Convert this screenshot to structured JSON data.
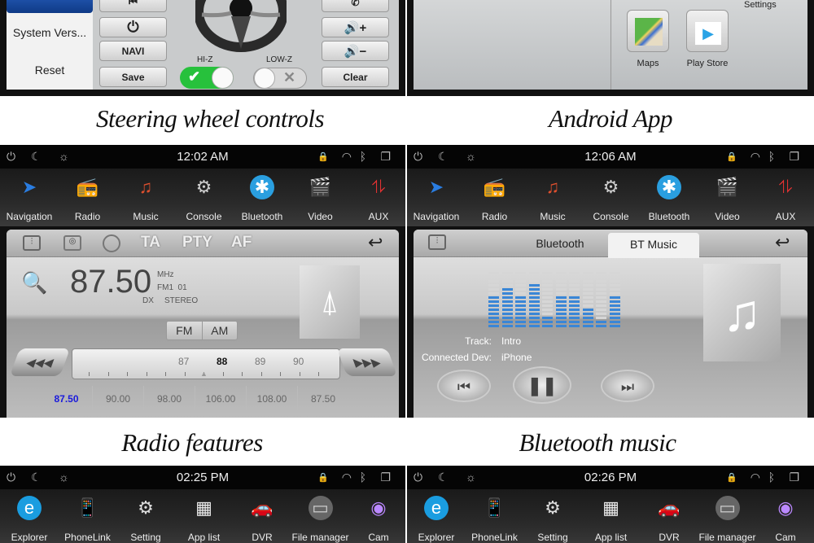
{
  "captions": {
    "steering": "Steering wheel controls",
    "android": "Android App",
    "radio": "Radio features",
    "bt_music": "Bluetooth music"
  },
  "steering": {
    "sidebar": [
      "System Vers...",
      "Reset"
    ],
    "left_buttons": [
      {
        "icon": "previous-track-icon"
      },
      {
        "icon": "power-icon"
      },
      {
        "label": "NAVI"
      },
      {
        "label": "Save"
      }
    ],
    "right_buttons": [
      {
        "icon": "phone-icon"
      },
      {
        "icon": "volume-up-icon"
      },
      {
        "icon": "volume-down-icon"
      },
      {
        "label": "Clear"
      }
    ],
    "hi_z": {
      "label": "HI-Z",
      "on": true
    },
    "low_z": {
      "label": "LOW-Z",
      "on": false
    },
    "accent": "#27c13c"
  },
  "android": {
    "apps": [
      {
        "label": "Maps",
        "icon": "maps-icon"
      },
      {
        "label": "Play Store",
        "icon": "play-store-icon"
      }
    ],
    "partial_label": "Settings"
  },
  "main_apps": [
    "Navigation",
    "Radio",
    "Music",
    "Console",
    "Bluetooth",
    "Video",
    "AUX"
  ],
  "bottom_apps": [
    "Explorer",
    "PhoneLink",
    "Setting",
    "App list",
    "DVR",
    "File manager",
    "Cam"
  ],
  "radio_screen": {
    "time": "12:02 AM",
    "toolbar": [
      "TA",
      "PTY",
      "AF"
    ],
    "frequency": "87.50",
    "unit": "MHz",
    "band_preset": "FM1  01",
    "dx": "DX",
    "stereo": "STEREO",
    "bands": [
      "FM",
      "AM"
    ],
    "dial": [
      "87",
      "88",
      "89",
      "90"
    ],
    "dial_active": "88",
    "presets": [
      "87.50",
      "90.00",
      "98.00",
      "106.00",
      "108.00",
      "87.50"
    ],
    "active_preset_color": "#1a1adc"
  },
  "bt_screen": {
    "time": "12:06 AM",
    "tabs": [
      "Bluetooth",
      "BT Music"
    ],
    "active_tab": "BT Music",
    "track_label": "Track:",
    "track": "Intro",
    "device_label": "Connected Dev:",
    "device": "iPhone",
    "eq_levels": [
      0.55,
      0.7,
      0.55,
      0.8,
      0.2,
      0.55,
      0.6,
      0.35,
      0.12,
      0.6
    ],
    "eq_color": "#3a86d6"
  },
  "bottom_left": {
    "time": "02:25 PM"
  },
  "bottom_right": {
    "time": "02:26 PM"
  }
}
